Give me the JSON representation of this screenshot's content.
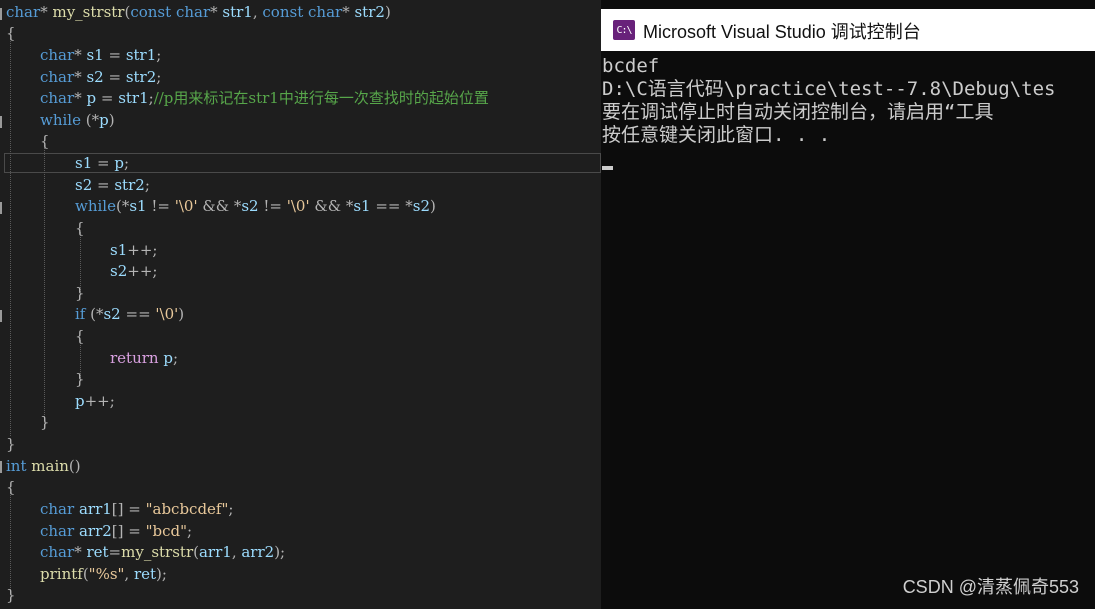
{
  "editor": {
    "l1": {
      "t1": "char",
      "t2": "* ",
      "t3": "my_strstr",
      "t4": "(",
      "t5": "const",
      "t6": " ",
      "t7": "char",
      "t8": "* ",
      "t9": "str1",
      "t10": ", ",
      "t11": "const",
      "t12": " ",
      "t13": "char",
      "t14": "* ",
      "t15": "str2",
      "t16": ")"
    },
    "l2": {
      "t1": "{"
    },
    "l3": {
      "t1": "char",
      "t2": "* ",
      "t3": "s1",
      "t4": " = ",
      "t5": "str1",
      "t6": ";"
    },
    "l4": {
      "t1": "char",
      "t2": "* ",
      "t3": "s2",
      "t4": " = ",
      "t5": "str2",
      "t6": ";"
    },
    "l5": {
      "t1": "char",
      "t2": "* ",
      "t3": "p",
      "t4": " = ",
      "t5": "str1",
      "t6": ";",
      "t7": "//p用来标记在str1中进行每一次查找时的起始位置"
    },
    "l6": {
      "t1": "while",
      "t2": " (*",
      "t3": "p",
      "t4": ")"
    },
    "l7": {
      "t1": "{"
    },
    "l8": {
      "t1": "s1",
      "t2": " = ",
      "t3": "p",
      "t4": ";"
    },
    "l9": {
      "t1": "s2",
      "t2": " = ",
      "t3": "str2",
      "t4": ";"
    },
    "l10": {
      "t1": "while",
      "t2": "(*",
      "t3": "s1",
      "t4": " != ",
      "t5": "'\\0'",
      "t6": " && *",
      "t7": "s2",
      "t8": " != ",
      "t9": "'\\0'",
      "t10": " && *",
      "t11": "s1",
      "t12": " == *",
      "t13": "s2",
      "t14": ")"
    },
    "l11": {
      "t1": "{"
    },
    "l12": {
      "t1": "s1",
      "t2": "++;"
    },
    "l13": {
      "t1": "s2",
      "t2": "++;"
    },
    "l14": {
      "t1": "}"
    },
    "l15": {
      "t1": "if",
      "t2": " (*",
      "t3": "s2",
      "t4": " == ",
      "t5": "'\\0'",
      "t6": ")"
    },
    "l16": {
      "t1": "{"
    },
    "l17": {
      "t1": "return",
      "t2": " ",
      "t3": "p",
      "t4": ";"
    },
    "l18": {
      "t1": "}"
    },
    "l19": {
      "t1": "p",
      "t2": "++;"
    },
    "l20": {
      "t1": "}"
    },
    "l21": {
      "t1": "}"
    },
    "l22": {
      "t1": "int",
      "t2": " ",
      "t3": "main",
      "t4": "()"
    },
    "l23": {
      "t1": "{"
    },
    "l24": {
      "t1": "char",
      "t2": " ",
      "t3": "arr1",
      "t4": "[] = ",
      "t5": "\"abcbcdef\"",
      "t6": ";"
    },
    "l25": {
      "t1": "char",
      "t2": " ",
      "t3": "arr2",
      "t4": "[] = ",
      "t5": "\"bcd\"",
      "t6": ";"
    },
    "l26": {
      "t1": "char",
      "t2": "* ",
      "t3": "ret",
      "t4": "=",
      "t5": "my_strstr",
      "t6": "(",
      "t7": "arr1",
      "t8": ", ",
      "t9": "arr2",
      "t10": ");"
    },
    "l27": {
      "t1": "printf",
      "t2": "(",
      "t3": "\"%s\"",
      "t4": ", ",
      "t5": "ret",
      "t6": ");"
    },
    "l28": {
      "t1": "}"
    }
  },
  "console": {
    "title": "Microsoft Visual Studio 调试控制台",
    "icon": "vs-console-icon",
    "icon_glyph": "C:\\",
    "lines": [
      "bcdef",
      "D:\\C语言代码\\practice\\test--7.8\\Debug\\tes",
      "要在调试停止时自动关闭控制台，请启用“工具",
      "按任意键关闭此窗口. . ."
    ]
  },
  "watermark": "CSDN @清蒸佩奇553"
}
